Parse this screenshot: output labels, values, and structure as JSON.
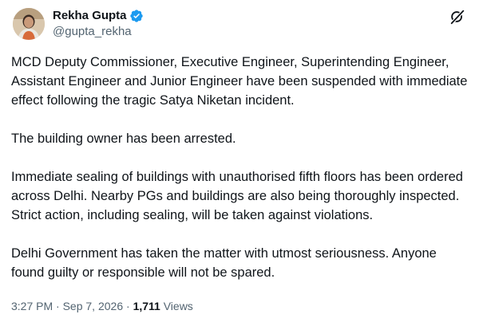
{
  "author": {
    "display_name": "Rekha Gupta",
    "handle": "@gupta_rekha",
    "verified": true
  },
  "tweet": {
    "paragraphs": [
      "MCD Deputy Commissioner, Executive Engineer, Superintending Engineer, Assistant Engineer and Junior Engineer have been suspended with immediate effect following the tragic Satya Niketan incident.",
      "The building owner has been arrested.",
      "Immediate sealing of buildings with unauthorised fifth floors has been ordered across Delhi. Nearby PGs and buildings are also being thoroughly inspected. Strict action, including sealing, will be taken against violations.",
      "Delhi Government has taken the matter with utmost seriousness. Anyone found guilty or responsible will not be spared."
    ]
  },
  "meta": {
    "time": "3:27 PM",
    "separator": " · ",
    "date": "Sep 7, 2026",
    "views_count": "1,711",
    "views_label": " Views"
  },
  "colors": {
    "text": "#0f1419",
    "secondary": "#536471",
    "verified_badge": "#1d9bf0"
  },
  "icons": {
    "verified": "verified-badge-icon",
    "grok": "grok-icon"
  }
}
